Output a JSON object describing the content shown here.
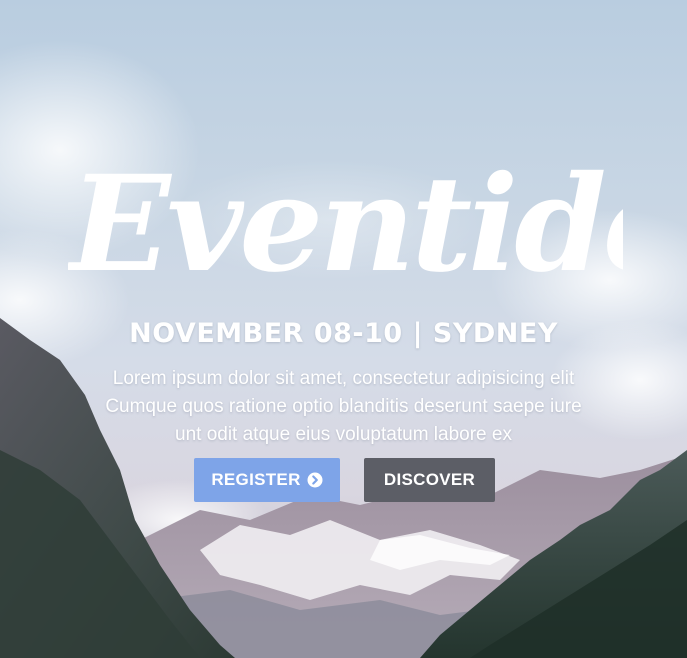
{
  "hero": {
    "logo_text": "Eventide",
    "date_line": "NOVEMBER 08-10 | SYDNEY",
    "tagline_lines": [
      "Lorem ipsum dolor sit amet, consectetur adipisicing elit",
      "Cumque quos ratione optio blanditis deserunt saepe iure",
      "unt odit atque eius voluptatum labore ex"
    ],
    "buttons": {
      "register_label": "REGISTER",
      "register_icon": "chevron-circle-right-icon",
      "discover_label": "DISCOVER"
    }
  },
  "colors": {
    "register_button": "#7ea4e8",
    "discover_button": "#5c5e66",
    "text": "#ffffff"
  }
}
